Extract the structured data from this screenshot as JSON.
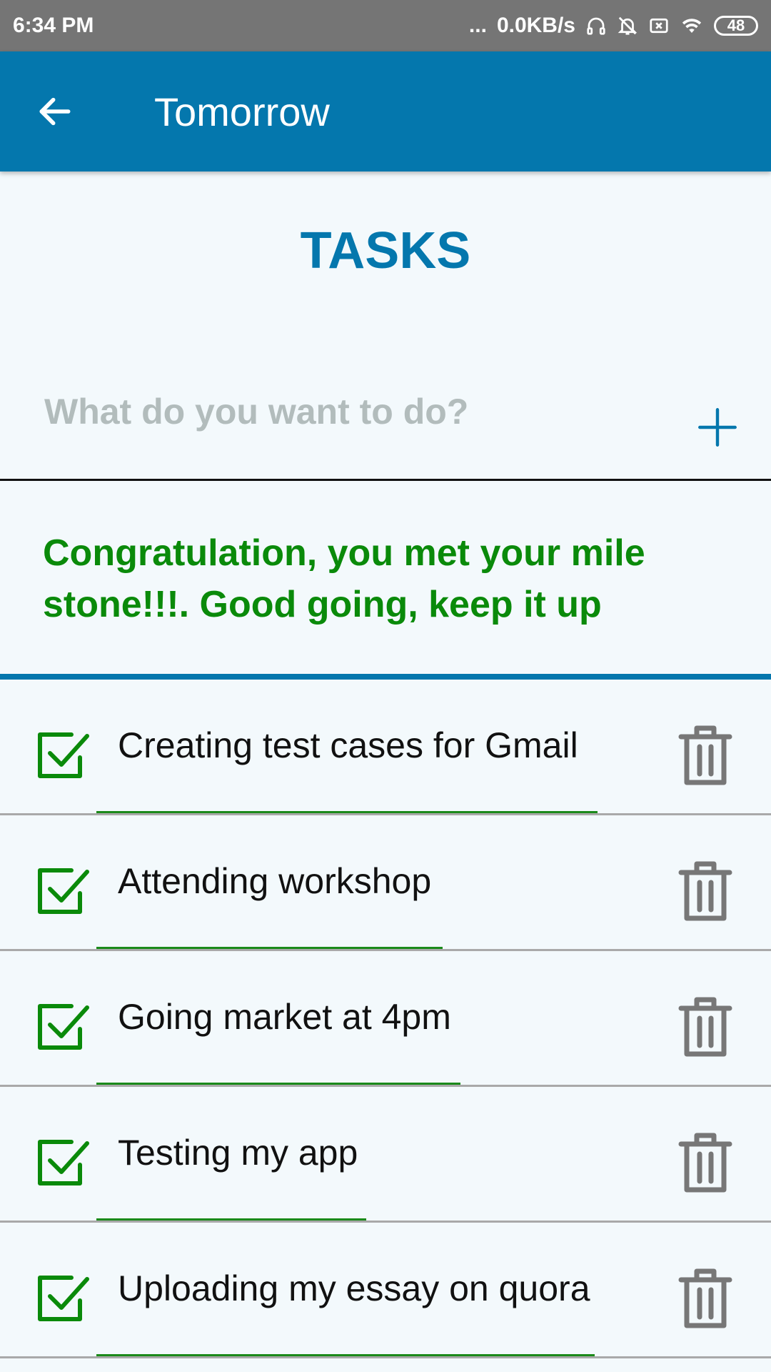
{
  "status_bar": {
    "time": "6:34 PM",
    "dots": "...",
    "speed": "0.0KB/s",
    "battery": "48",
    "icons": [
      "headset-icon",
      "mute-bell-icon",
      "sim-x-icon",
      "wifi-icon",
      "battery-icon"
    ]
  },
  "app_bar": {
    "title": "Tomorrow",
    "back_icon": "arrow-left-icon"
  },
  "heading": "TASKS",
  "input": {
    "placeholder": "What do you want to do?",
    "value": "",
    "add_icon": "plus-icon"
  },
  "congrats": "Congratulation, you met your mile stone!!!. Good going, keep it up",
  "tasks": [
    {
      "label": "Creating test cases for Gmail",
      "done": true
    },
    {
      "label": "Attending workshop",
      "done": true
    },
    {
      "label": "Going market at 4pm",
      "done": true
    },
    {
      "label": "Testing my app",
      "done": true
    },
    {
      "label": "Uploading my essay on quora",
      "done": true
    }
  ],
  "colors": {
    "primary": "#0477ad",
    "success": "#0a8a0a",
    "icon_gray": "#777777",
    "background": "#f3f9fc"
  }
}
